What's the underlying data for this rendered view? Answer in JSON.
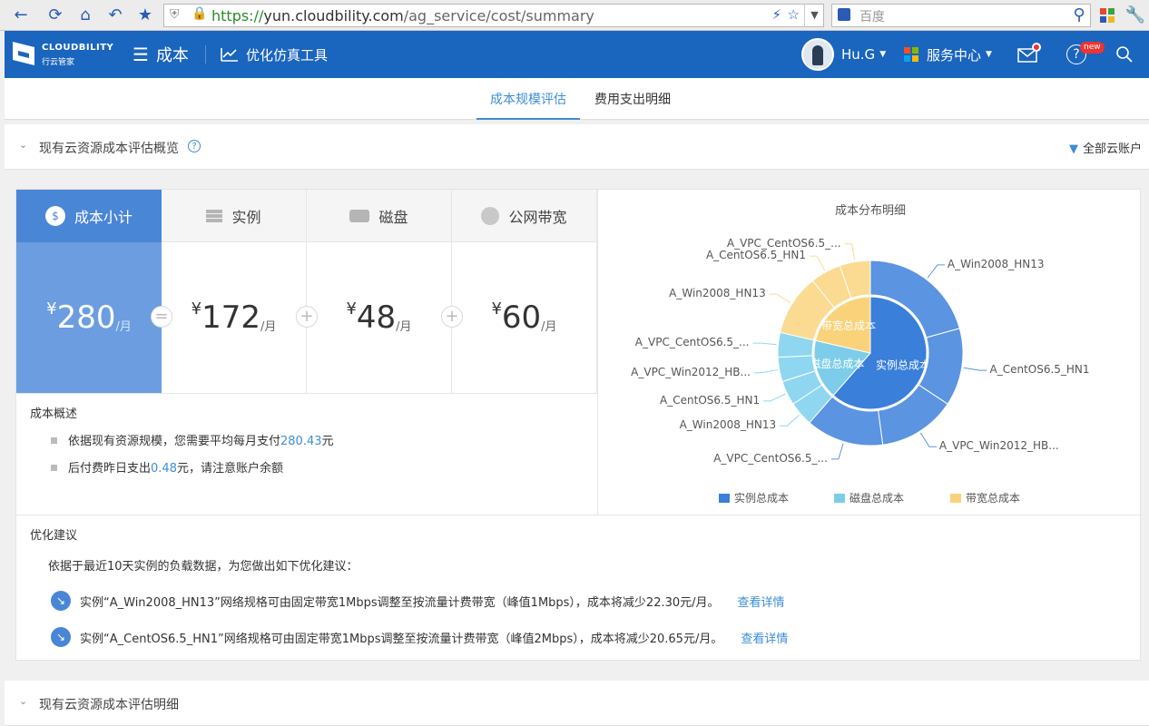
{
  "browser": {
    "url_scheme": "https://",
    "url_host": "yun.cloudbility.com",
    "url_path": "/ag_service/cost/summary",
    "search_placeholder": "百度"
  },
  "app": {
    "logo_text": "CLOUDBILITY",
    "logo_subtext": "行云管家",
    "nav_title": "成本",
    "tool_link": "优化仿真工具",
    "user": "Hu.G",
    "service_center": "服务中心",
    "new_badge": "new"
  },
  "tabs": [
    {
      "label": "成本规模评估",
      "active": true
    },
    {
      "label": "费用支出明细",
      "active": false
    }
  ],
  "section1": {
    "title": "现有云资源成本评估概览",
    "filter": "全部云账户"
  },
  "kpis": [
    {
      "label": "成本小计",
      "currency": "¥",
      "value": "280",
      "unit": "/月",
      "active": true
    },
    {
      "label": "实例",
      "currency": "¥",
      "value": "172",
      "unit": "/月",
      "active": false
    },
    {
      "label": "磁盘",
      "currency": "¥",
      "value": "48",
      "unit": "/月",
      "active": false
    },
    {
      "label": "公网带宽",
      "currency": "¥",
      "value": "60",
      "unit": "/月",
      "active": false
    }
  ],
  "operators": [
    "=",
    "+",
    "+"
  ],
  "overview": {
    "title": "成本概述",
    "line1_pre": "依据现有资源规模，您需要平均每月支付",
    "line1_val": "280.43",
    "line1_post": "元",
    "line2_pre": "后付费昨日支出",
    "line2_val": "0.48",
    "line2_post": "元，请注意账户余额"
  },
  "suggestions": {
    "title": "优化建议",
    "intro": "依据于最近10天实例的负载数据，为您做出如下优化建议：",
    "items": [
      {
        "text": "实例“A_Win2008_HN13”网络规格可由固定带宽1Mbps调整至按流量计费带宽（峰值1Mbps），成本将减少22.30元/月。",
        "link": "查看详情"
      },
      {
        "text": "实例“A_CentOS6.5_HN1”网络规格可由固定带宽1Mbps调整至按流量计费带宽（峰值2Mbps），成本将减少20.65元/月。",
        "link": "查看详情"
      }
    ]
  },
  "section2": {
    "title": "现有云资源成本评估明细"
  },
  "colors": {
    "instance": "#3a7fd9",
    "disk": "#7dcdea",
    "bandwidth": "#f9d27a",
    "instance_outer": "#5b94e0"
  },
  "chart_data": {
    "type": "pie",
    "title": "成本分布明细",
    "inner": [
      {
        "name": "实例总成本",
        "value": 172
      },
      {
        "name": "磁盘总成本",
        "value": 48
      },
      {
        "name": "带宽总成本",
        "value": 60
      }
    ],
    "outer": [
      {
        "group": "实例总成本",
        "name": "A_Win2008_HN13",
        "value": 58
      },
      {
        "group": "实例总成本",
        "name": "A_CentOS6.5_HN1",
        "value": 38
      },
      {
        "group": "实例总成本",
        "name": "A_VPC_Win2012_HB...",
        "value": 38
      },
      {
        "group": "实例总成本",
        "name": "A_VPC_CentOS6.5_...",
        "value": 38
      },
      {
        "group": "磁盘总成本",
        "name": "A_Win2008_HN13",
        "value": 12
      },
      {
        "group": "磁盘总成本",
        "name": "A_CentOS6.5_HN1",
        "value": 12
      },
      {
        "group": "磁盘总成本",
        "name": "A_VPC_Win2012_HB...",
        "value": 12
      },
      {
        "group": "磁盘总成本",
        "name": "A_VPC_CentOS6.5_...",
        "value": 12
      },
      {
        "group": "带宽总成本",
        "name": "A_Win2008_HN13",
        "value": 30
      },
      {
        "group": "带宽总成本",
        "name": "A_CentOS6.5_HN1",
        "value": 15
      },
      {
        "group": "带宽总成本",
        "name": "A_VPC_CentOS6.5_...",
        "value": 15
      }
    ],
    "legend": [
      "实例总成本",
      "磁盘总成本",
      "带宽总成本"
    ],
    "legend_position": "bottom"
  }
}
